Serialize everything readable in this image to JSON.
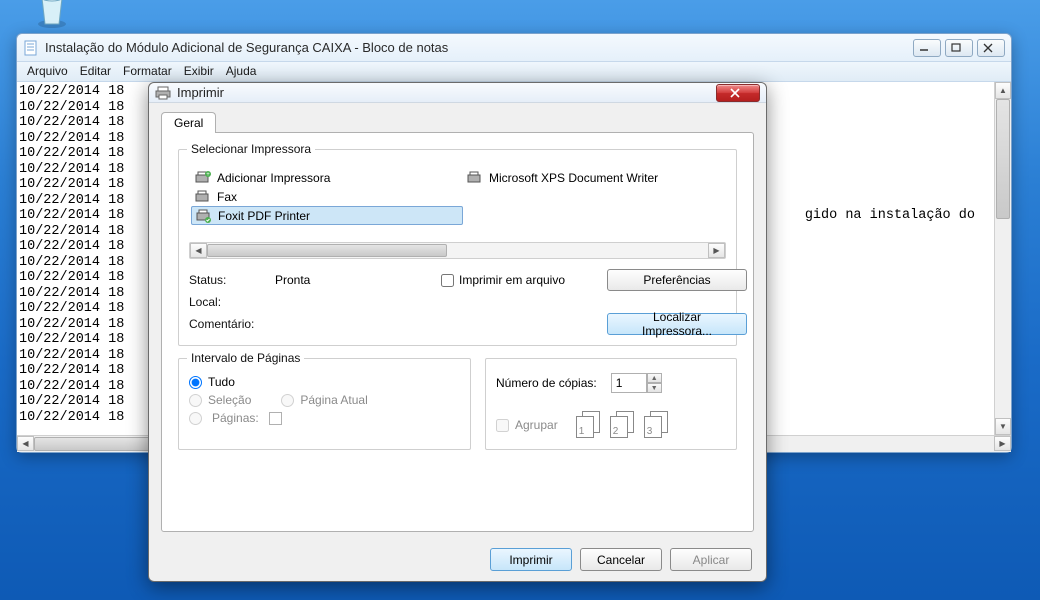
{
  "desktop": {
    "recycle_bin_label": ""
  },
  "notepad": {
    "title": "Instalação do Módulo Adicional de Segurança CAIXA - Bloco de notas",
    "menu": [
      "Arquivo",
      "Editar",
      "Formatar",
      "Exibir",
      "Ajuda"
    ],
    "lines": [
      "10/22/2014 18",
      "10/22/2014 18",
      "10/22/2014 18",
      "10/22/2014 18",
      "10/22/2014 18",
      "10/22/2014 18",
      "10/22/2014 18",
      "10/22/2014 18",
      "10/22/2014 18                                                                                    gido na instalação do",
      "10/22/2014 18",
      "10/22/2014 18",
      "10/22/2014 18",
      "10/22/2014 18",
      "10/22/2014 18",
      "10/22/2014 18",
      "10/22/2014 18",
      "10/22/2014 18",
      "10/22/2014 18",
      "10/22/2014 18",
      "10/22/2014 18",
      "10/22/2014 18",
      "10/22/2014 18"
    ]
  },
  "print": {
    "title": "Imprimir",
    "tab_general": "Geral",
    "group_select_printer": "Selecionar Impressora",
    "printers": {
      "add": "Adicionar Impressora",
      "fax": "Fax",
      "foxit": "Foxit PDF Printer",
      "xps": "Microsoft XPS Document Writer"
    },
    "status_label": "Status:",
    "status_value": "Pronta",
    "local_label": "Local:",
    "comment_label": "Comentário:",
    "print_to_file": "Imprimir em arquivo",
    "preferences_btn": "Preferências",
    "find_printer_btn": "Localizar Impressora...",
    "group_page_range": "Intervalo de Páginas",
    "radio_all": "Tudo",
    "radio_selection": "Seleção",
    "radio_current": "Página Atual",
    "radio_pages": "Páginas:",
    "copies_label": "Número de cópias:",
    "copies_value": "1",
    "collate_label": "Agrupar",
    "collate_pages": [
      "1",
      "1",
      "2",
      "2",
      "3",
      "3"
    ],
    "btn_print": "Imprimir",
    "btn_cancel": "Cancelar",
    "btn_apply": "Aplicar"
  }
}
